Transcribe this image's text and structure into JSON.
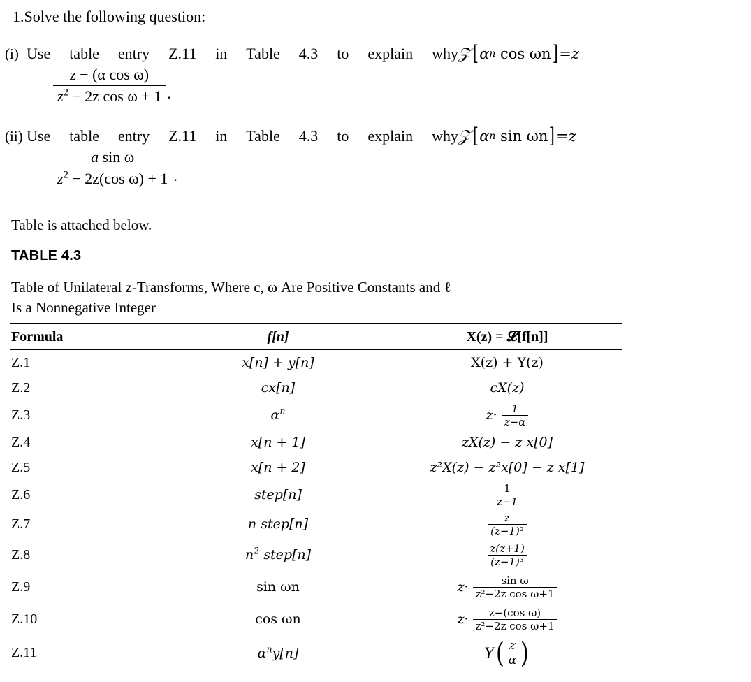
{
  "document": {
    "heading": "1.Solve the following question:",
    "attached_note": "Table is attached below.",
    "table_label": "TABLE 4.3",
    "table_caption_line1": "Table of Unilateral z-Transforms, Where c, ω Are Positive Constants and ℓ",
    "table_caption_line2": "Is a Nonnegative Integer"
  },
  "questions": [
    {
      "marker": "(i)",
      "words": [
        "Use",
        "table",
        "entry",
        "Z.11",
        "in",
        "Table",
        "4.3",
        "to",
        "explain",
        "why"
      ],
      "expr_lhs": "ℤ[αⁿ cos ωn]",
      "expr_eq": "=",
      "expr_rhs_lead": "z",
      "fraction_numerator": "z − (α cos ω)",
      "fraction_denominator": "z² − 2z cos ω + 1",
      "trailing": ".",
      "bracket_inner_base": "α",
      "bracket_inner_exp": "n",
      "bracket_inner_fn": "cos ωn",
      "num_a": "z",
      "num_minus": "−",
      "num_paren": "(α cos ω)",
      "den_z": "z",
      "den_exp": "2",
      "den_rest": "− 2z cos ω + 1"
    },
    {
      "marker": "(ii)",
      "words": [
        "Use",
        "table",
        "entry",
        "Z.11",
        "in",
        "Table",
        "4.3",
        "to",
        "explain",
        "why"
      ],
      "expr_lhs": "ℤ[αⁿ sin ωn]",
      "expr_eq": "=",
      "expr_rhs_lead": "z",
      "fraction_numerator": "a sin ω",
      "fraction_denominator": "z² − 2z(cos ω) + 1",
      "trailing": ".",
      "bracket_inner_base": "α",
      "bracket_inner_exp": "n",
      "bracket_inner_fn": "sin ωn",
      "num_a": "a",
      "num_rest": "sin ω",
      "den_z": "z",
      "den_exp": "2",
      "den_rest": "− 2z(cos ω) + 1"
    }
  ],
  "table": {
    "headers": {
      "formula": "Formula",
      "fn": "f[n]",
      "xz": "X(z) = 𝓛[f[n]]",
      "xz_part1": "X(z) = ",
      "xz_script": "ℒ",
      "xz_part2": "[f[n]]"
    },
    "rows": [
      {
        "id": "Z.1",
        "fn": "x[n] + y[n]",
        "xz": "X(z) + Y(z)",
        "kind": "plain"
      },
      {
        "id": "Z.2",
        "fn": "cx[n]",
        "xz": "cX(z)",
        "kind": "plain"
      },
      {
        "id": "Z.3",
        "fn": "αⁿ",
        "xz": "z· 1/(z−α)",
        "kind": "zfrac",
        "num": "1",
        "den": "z−α"
      },
      {
        "id": "Z.4",
        "fn": "x[n + 1]",
        "xz": "zX(z) − z x[0]",
        "kind": "plain"
      },
      {
        "id": "Z.5",
        "fn": "x[n + 2]",
        "xz": "z²X(z) − z²x[0] − z x[1]",
        "kind": "plain"
      },
      {
        "id": "Z.6",
        "fn": "step[n]",
        "xz": "1/(z−1)",
        "kind": "frac",
        "num": "1",
        "den": "z−1"
      },
      {
        "id": "Z.7",
        "fn": "n step[n]",
        "xz": "z/(z−1)²",
        "kind": "frac",
        "num": "z",
        "den": "(z−1)²"
      },
      {
        "id": "Z.8",
        "fn": "n² step[n]",
        "xz": "z(z+1)/(z−1)³",
        "kind": "frac",
        "num": "z(z+1)",
        "den": "(z−1)³"
      },
      {
        "id": "Z.9",
        "fn": "sin ωn",
        "xz": "z· sin ω/(z²−2z cos ω+1)",
        "kind": "zfrac",
        "num": "sin ω",
        "den": "z²−2z cos ω+1"
      },
      {
        "id": "Z.10",
        "fn": "cos ωn",
        "xz": "z· z−(cos ω)/(z²−2z cos ω+1)",
        "kind": "zfrac",
        "num": "z−(cos ω)",
        "den": "z²−2z cos ω+1"
      },
      {
        "id": "Z.11",
        "fn": "αⁿy[n]",
        "xz": "Y(z/α)",
        "kind": "yparen",
        "num": "z",
        "den": "α",
        "fnname": "Y"
      }
    ]
  }
}
